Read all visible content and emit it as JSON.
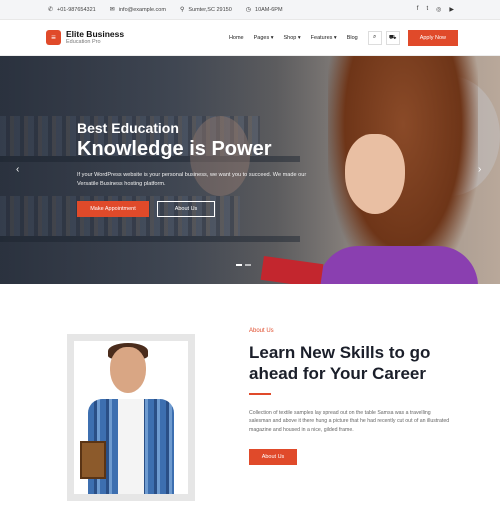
{
  "topbar": {
    "phone": "+01-987654321",
    "email": "info@example.com",
    "address": "Sumter,SC 29150",
    "hours": "10AM-6PM",
    "social_icons": [
      "facebook-icon",
      "twitter-icon",
      "instagram-icon",
      "youtube-icon"
    ]
  },
  "header": {
    "logo_title": "Elite Business",
    "logo_subtitle": "Education Pro",
    "nav": [
      "Home",
      "Pages",
      "Shop",
      "Features",
      "Blog"
    ],
    "nav_caret": "▾",
    "apply_label": "Apply Now"
  },
  "hero": {
    "subtitle": "Best Education",
    "title": "Knowledge is Power",
    "description": "If your WordPress website is your personal business, we want you to succeed. We made our Versatile Business hosting platform.",
    "primary_button": "Make Appointment",
    "secondary_button": "About Us",
    "prev_arrow": "‹",
    "next_arrow": "›"
  },
  "about": {
    "kicker": "About Us",
    "heading": "Learn New Skills to go ahead for Your Career",
    "body": "Collection of textile samples lay spread out on the table Samsa was a travelling salesman and above it there hung a picture that he had recently cut out of an illustrated magazine and housed in a nice, gilded frame.",
    "button": "About Us"
  },
  "colors": {
    "accent": "#e04a2a",
    "topbar_bg": "#f4f5f7",
    "heading": "#1b1f2a"
  }
}
